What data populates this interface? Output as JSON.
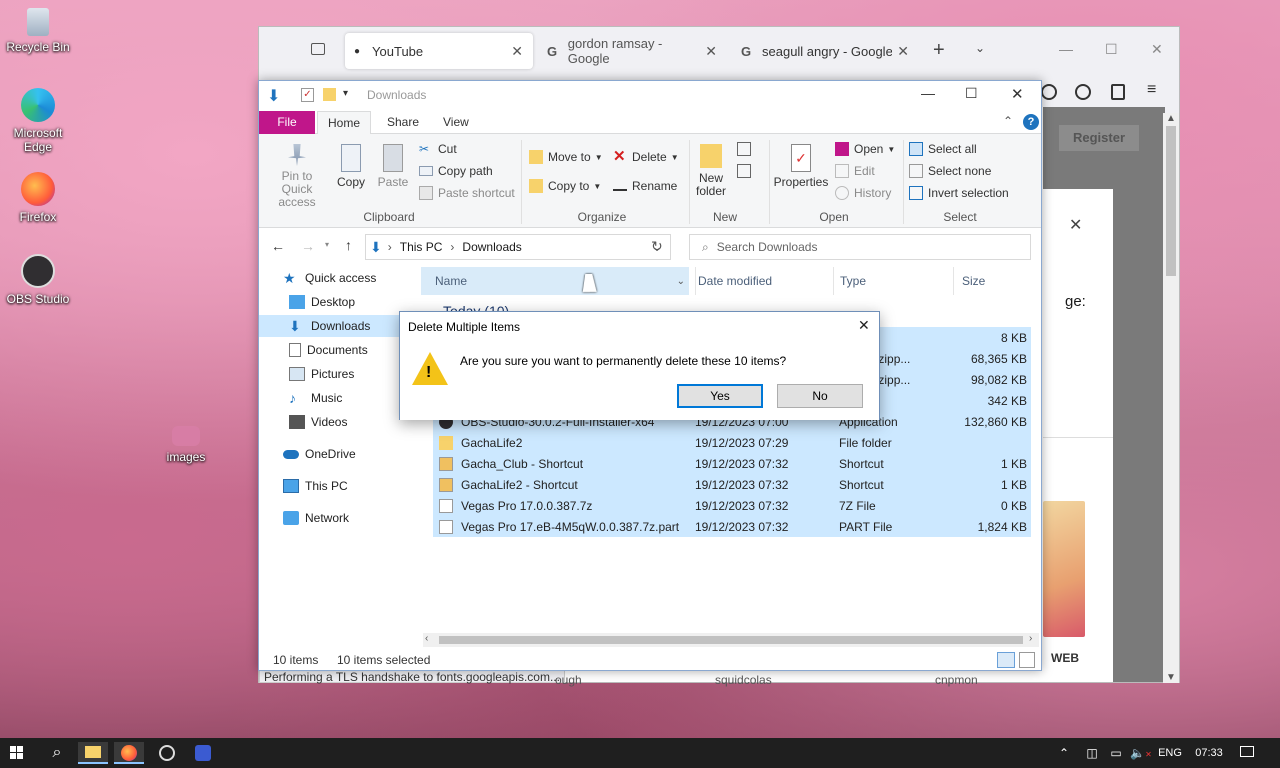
{
  "desktop": {
    "icons": [
      {
        "label": "Recycle Bin"
      },
      {
        "label": "Microsoft Edge"
      },
      {
        "label": "Firefox"
      },
      {
        "label": "OBS Studio"
      },
      {
        "label": "images"
      }
    ]
  },
  "browser": {
    "tabs": [
      {
        "label": "YouTube"
      },
      {
        "label": "gordon ramsay - Google"
      },
      {
        "label": "seagull angry - Google Se"
      }
    ],
    "register_label": "Register",
    "page_partial_text": "ge:",
    "badge_label": "WEB",
    "status_text": "Performing a TLS handshake to fonts.googleapis.com...",
    "bottom_texts": [
      "ough",
      "squidcolas",
      "cnpmon"
    ]
  },
  "explorer": {
    "title": "Downloads",
    "ribbon_tabs": {
      "file": "File",
      "home": "Home",
      "share": "Share",
      "view": "View"
    },
    "clipboard": {
      "pin": "Pin to Quick access",
      "copy": "Copy",
      "paste": "Paste",
      "cut": "Cut",
      "copy_path": "Copy path",
      "paste_shortcut": "Paste shortcut",
      "label": "Clipboard"
    },
    "organize": {
      "move_to": "Move to",
      "copy_to": "Copy to",
      "delete": "Delete",
      "rename": "Rename",
      "label": "Organize"
    },
    "new": {
      "new_folder": "New folder",
      "label": "New"
    },
    "open": {
      "properties": "Properties",
      "open": "Open",
      "edit": "Edit",
      "history": "History",
      "label": "Open"
    },
    "select": {
      "select_all": "Select all",
      "select_none": "Select none",
      "invert": "Invert selection",
      "label": "Select"
    },
    "address": {
      "this_pc": "This PC",
      "downloads": "Downloads"
    },
    "search_placeholder": "Search Downloads",
    "nav": [
      {
        "label": "Quick access"
      },
      {
        "label": "Desktop"
      },
      {
        "label": "Downloads"
      },
      {
        "label": "Documents"
      },
      {
        "label": "Pictures"
      },
      {
        "label": "Music"
      },
      {
        "label": "Videos"
      },
      {
        "label": "OneDrive"
      },
      {
        "label": "This PC"
      },
      {
        "label": "Network"
      }
    ],
    "columns": {
      "name": "Name",
      "date": "Date modified",
      "type": "Type",
      "size": "Size"
    },
    "group_header": "Today (10)",
    "files": [
      {
        "name": "",
        "date": "",
        "type": "",
        "size": "8 KB"
      },
      {
        "name": "",
        "date": "",
        "type": "essed (zipp...",
        "size": "68,365 KB"
      },
      {
        "name": "",
        "date": "",
        "type": "essed (zipp...",
        "size": "98,082 KB"
      },
      {
        "name": "",
        "date": "",
        "type": "ation",
        "size": "342 KB"
      },
      {
        "name": "OBS-Studio-30.0.2-Full-Installer-x64",
        "date": "19/12/2023 07:00",
        "type": "Application",
        "size": "132,860 KB"
      },
      {
        "name": "GachaLife2",
        "date": "19/12/2023 07:29",
        "type": "File folder",
        "size": ""
      },
      {
        "name": "Gacha_Club - Shortcut",
        "date": "19/12/2023 07:32",
        "type": "Shortcut",
        "size": "1 KB"
      },
      {
        "name": "GachaLife2 - Shortcut",
        "date": "19/12/2023 07:32",
        "type": "Shortcut",
        "size": "1 KB"
      },
      {
        "name": "Vegas Pro 17.0.0.387.7z",
        "date": "19/12/2023 07:32",
        "type": "7Z File",
        "size": "0 KB"
      },
      {
        "name": "Vegas Pro 17.eB-4M5qW.0.0.387.7z.part",
        "date": "19/12/2023 07:32",
        "type": "PART File",
        "size": "1,824 KB"
      }
    ],
    "status": {
      "count": "10 items",
      "selected": "10 items selected"
    }
  },
  "dialog": {
    "title": "Delete Multiple Items",
    "message": "Are you sure you want to permanently delete these 10 items?",
    "yes": "Yes",
    "no": "No"
  },
  "taskbar": {
    "lang": "ENG",
    "time": "07:33"
  }
}
